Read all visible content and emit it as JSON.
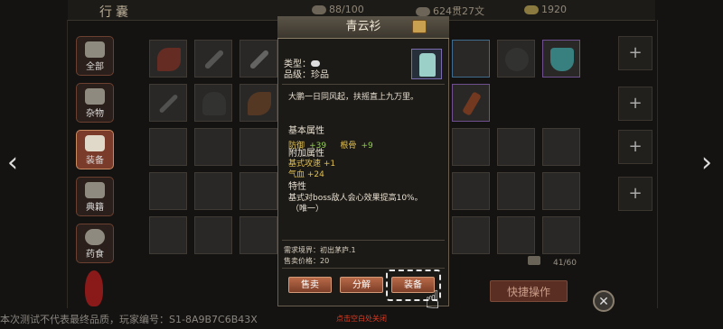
{
  "header": {
    "title": "行囊",
    "res1": "88/100",
    "res2": "624贯27文",
    "res3": "1920"
  },
  "tabs": [
    {
      "label": "全部"
    },
    {
      "label": "杂物"
    },
    {
      "label": "装备"
    },
    {
      "label": "典籍"
    },
    {
      "label": "药食"
    }
  ],
  "inventory": {
    "counter": "41/60"
  },
  "popup": {
    "title": "青云衫",
    "type_label": "类型：",
    "grade_label": "品级：",
    "grade_value": "珍品",
    "description": "大鹏一日同风起，扶摇直上九万里。",
    "basic_title": "基本属性",
    "basic_attr1_name": "防御",
    "basic_attr1_value": "+39",
    "basic_attr2_name": "根骨",
    "basic_attr2_value": "+9",
    "extra_title": "附加属性",
    "extra_attr1": "基式攻速 +1",
    "extra_attr2": "气血 +24",
    "trait_title": "特性",
    "trait_text": "基式对boss敌人会心效果提高10%。",
    "trait_note": "（唯一）",
    "requirement": "需求境界：初出茅庐.1",
    "price": "售卖价格：20",
    "btn_sell": "售卖",
    "btn_decompose": "分解",
    "btn_equip": "装备"
  },
  "quick_action": "快捷操作",
  "footer": {
    "notice": "本次测试不代表最终品质，玩家编号：S1-8A9B7C6B43X",
    "close_hint": "点击空白处关闭"
  },
  "colors": {
    "accent": "#7b3b2a",
    "stat_green": "#8fd04a",
    "stat_yellow": "#e0c050",
    "close_hint": "#e03a20"
  }
}
